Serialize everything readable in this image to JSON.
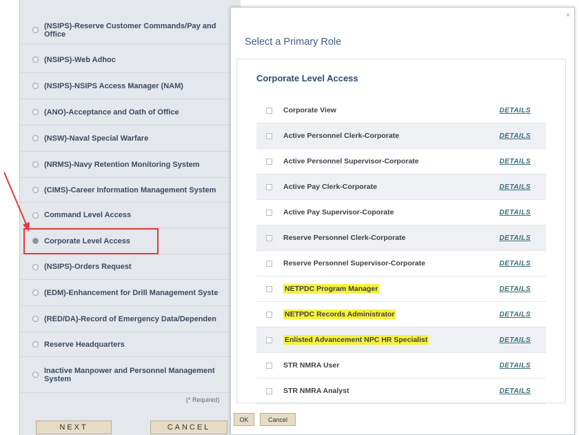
{
  "background": {
    "options": [
      {
        "label": "(NSIPS)-Reserve Customer Commands/Pay and Office",
        "selected": false
      },
      {
        "label": "(NSIPS)-Web Adhoc",
        "selected": false
      },
      {
        "label": "(NSIPS)-NSIPS Access Manager (NAM)",
        "selected": false
      },
      {
        "label": "(ANO)-Acceptance and Oath of Office",
        "selected": false
      },
      {
        "label": "(NSW)-Naval Special Warfare",
        "selected": false
      },
      {
        "label": "(NRMS)-Navy Retention Monitoring System",
        "selected": false
      },
      {
        "label": "(CIMS)-Career Information Management System",
        "selected": false
      },
      {
        "label": "Command Level Access",
        "selected": false
      },
      {
        "label": "Corporate Level Access",
        "selected": true
      },
      {
        "label": "(NSIPS)-Orders Request",
        "selected": false
      },
      {
        "label": "(EDM)-Enhancement for Drill Management Syste",
        "selected": false
      },
      {
        "label": "(RED/DA)-Record of Emergency Data/Dependen",
        "selected": false
      },
      {
        "label": "Reserve Headquarters",
        "selected": false
      },
      {
        "label": "Inactive Manpower and Personnel Management System",
        "selected": false
      }
    ],
    "required_note": "(* Required)",
    "next_label": "NEXT",
    "cancel_label": "CANCEL"
  },
  "modal": {
    "close_symbol": "×",
    "title": "Select a Primary Role",
    "section_header": "Corporate Level Access",
    "roles": [
      {
        "name": "Corporate View",
        "details": "DETAILS",
        "highlighted": false
      },
      {
        "name": "Active Personnel Clerk-Corporate",
        "details": "DETAILS",
        "highlighted": false
      },
      {
        "name": "Active Personnel Supervisor-Corporate",
        "details": "DETAILS",
        "highlighted": false
      },
      {
        "name": "Active Pay Clerk-Corporate",
        "details": "DETAILS",
        "highlighted": false
      },
      {
        "name": "Active Pay Supervisor-Coporate",
        "details": "DETAILS",
        "highlighted": false
      },
      {
        "name": "Reserve Personnel Clerk-Corporate",
        "details": "DETAILS",
        "highlighted": false
      },
      {
        "name": "Reserve Personnel Supervisor-Corporate",
        "details": "DETAILS",
        "highlighted": false
      },
      {
        "name": "NETPDC Program Manager",
        "details": "DETAILS",
        "highlighted": true
      },
      {
        "name": "NETPDC Records Administrator",
        "details": "DETAILS",
        "highlighted": true
      },
      {
        "name": "Enlisted Advancement NPC HR Specialist",
        "details": "DETAILS",
        "highlighted": true
      },
      {
        "name": "STR NMRA User",
        "details": "DETAILS",
        "highlighted": false
      },
      {
        "name": "STR NMRA Analyst",
        "details": "DETAILS",
        "highlighted": false
      }
    ],
    "ok_label": "OK",
    "cancel_label": "Cancel"
  },
  "colors": {
    "annotation_red": "#e23a3a",
    "highlight_yellow": "#f7f13d",
    "title_blue": "#3f5e8a",
    "details_teal": "#3a6c7d"
  }
}
